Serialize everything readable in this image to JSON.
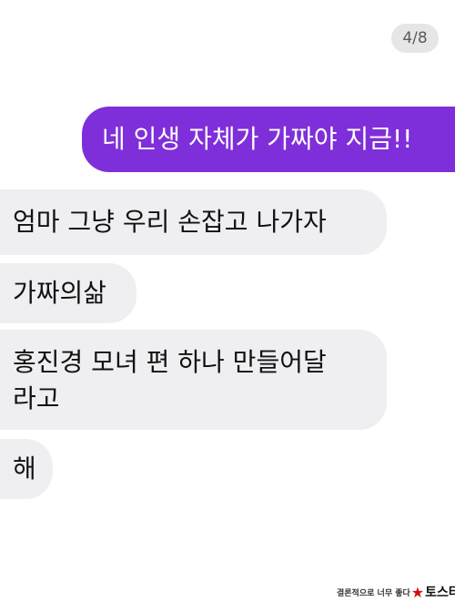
{
  "page_counter": "4/8",
  "messages": [
    {
      "direction": "sent",
      "text": "네 인생 자체가 가짜야 지금!!"
    },
    {
      "direction": "received",
      "text": "엄마 그냥 우리 손잡고 나가자"
    },
    {
      "direction": "received",
      "text": "가짜의삶"
    },
    {
      "direction": "received",
      "lines": [
        "홍진경 모녀 편 하나 만들어달",
        "라고"
      ]
    },
    {
      "direction": "received",
      "text": "해"
    }
  ],
  "watermark": {
    "caption": "결론적으로 너무 좋다",
    "brand": "토스타",
    "star_icon": "star-icon"
  },
  "colors": {
    "sent_bubble": "#7f2fd9",
    "received_bubble": "#efeff2",
    "counter_bg": "#e6e6e6"
  }
}
